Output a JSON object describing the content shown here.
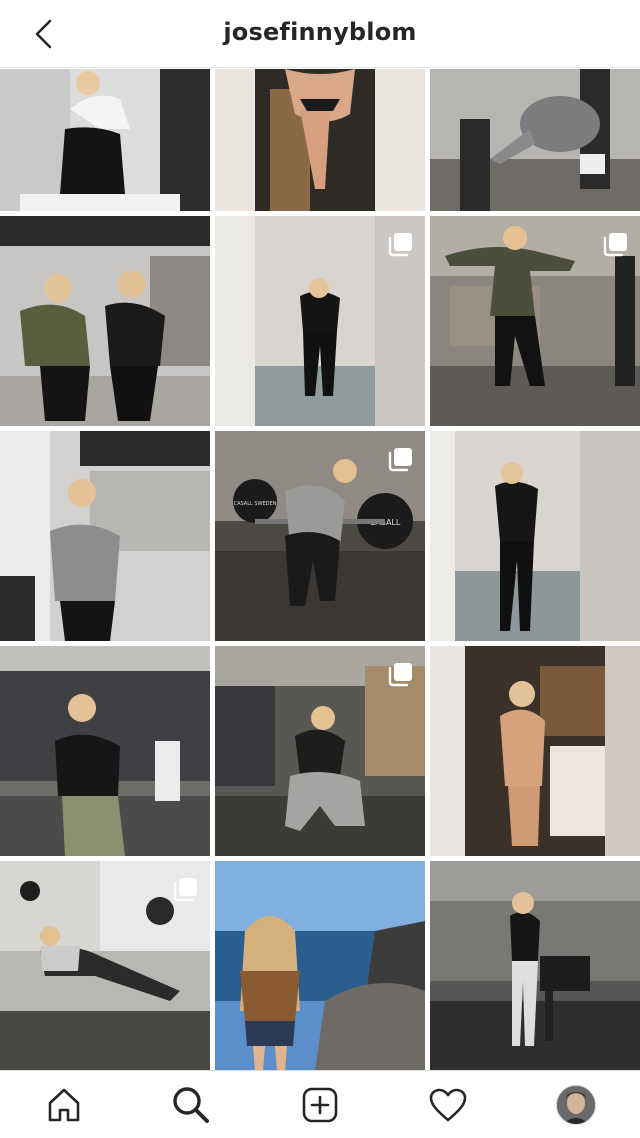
{
  "header": {
    "username": "josefinnyblom",
    "back_icon": "chevron-left-icon"
  },
  "posts": [
    {
      "id": 1,
      "multi": false
    },
    {
      "id": 2,
      "multi": false
    },
    {
      "id": 3,
      "multi": false
    },
    {
      "id": 4,
      "multi": false
    },
    {
      "id": 5,
      "multi": true
    },
    {
      "id": 6,
      "multi": true
    },
    {
      "id": 7,
      "multi": false
    },
    {
      "id": 8,
      "multi": true
    },
    {
      "id": 9,
      "multi": false
    },
    {
      "id": 10,
      "multi": false
    },
    {
      "id": 11,
      "multi": true
    },
    {
      "id": 12,
      "multi": false
    },
    {
      "id": 13,
      "multi": true
    },
    {
      "id": 14,
      "multi": false
    },
    {
      "id": 15,
      "multi": false
    }
  ],
  "plate_texts": {
    "left": "CASALL SWEDEN",
    "right": "CASALL"
  },
  "tabbar": {
    "items": [
      "home-icon",
      "search-icon",
      "new-post-icon",
      "activity-heart-icon",
      "profile-avatar"
    ]
  }
}
